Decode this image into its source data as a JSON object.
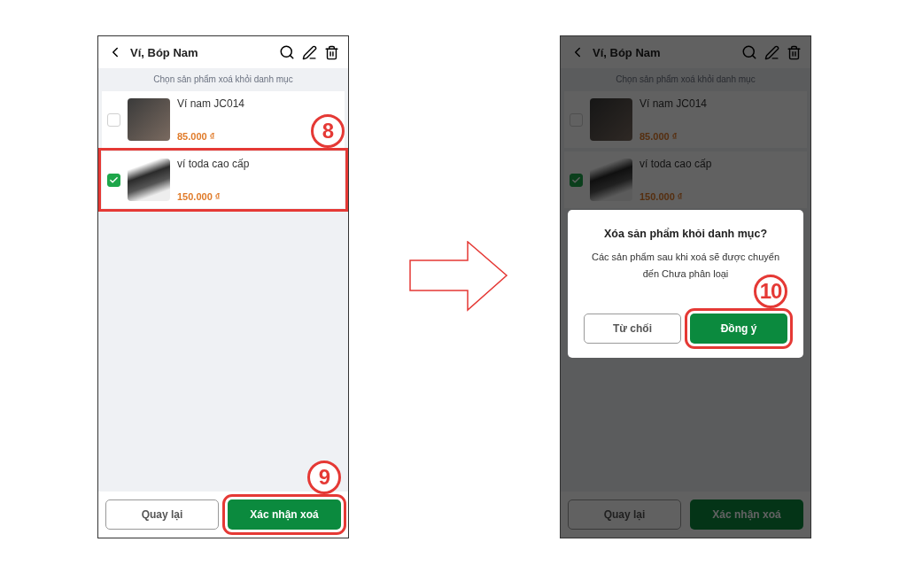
{
  "screens": [
    {
      "header": {
        "title": "Ví, Bóp Nam"
      },
      "hint": "Chọn sản phẩm xoá khỏi danh mục",
      "items": [
        {
          "name": "Ví nam JC014",
          "price": "85.000 ₫",
          "checked": false,
          "highlighted": false
        },
        {
          "name": "ví toda cao cấp",
          "price": "150.000 ₫",
          "checked": true,
          "highlighted": true,
          "annotation": "8"
        }
      ],
      "buttons": [
        {
          "label": "Quay lại",
          "kind": "secondary",
          "highlighted": false
        },
        {
          "label": "Xác nhận xoá",
          "kind": "primary",
          "highlighted": true,
          "annotation": "9"
        }
      ]
    },
    {
      "header": {
        "title": "Ví, Bóp Nam"
      },
      "hint": "Chọn sản phẩm xoá khỏi danh mục",
      "items": [
        {
          "name": "Ví nam JC014",
          "price": "85.000 ₫",
          "checked": false,
          "highlighted": false
        },
        {
          "name": "ví toda cao cấp",
          "price": "150.000 ₫",
          "checked": true,
          "highlighted": false
        }
      ],
      "buttons": [
        {
          "label": "Quay lại",
          "kind": "secondary",
          "highlighted": false
        },
        {
          "label": "Xác nhận xoá",
          "kind": "primary",
          "highlighted": false
        }
      ],
      "dialog": {
        "title": "Xóa sản phẩm khỏi danh mục?",
        "message": "Các sản phẩm sau khi xoá sẽ được chuyển đến Chưa phân loại",
        "buttons": [
          {
            "label": "Từ chối",
            "kind": "secondary",
            "highlighted": false
          },
          {
            "label": "Đồng ý",
            "kind": "primary",
            "highlighted": true,
            "annotation": "10"
          }
        ]
      }
    }
  ]
}
